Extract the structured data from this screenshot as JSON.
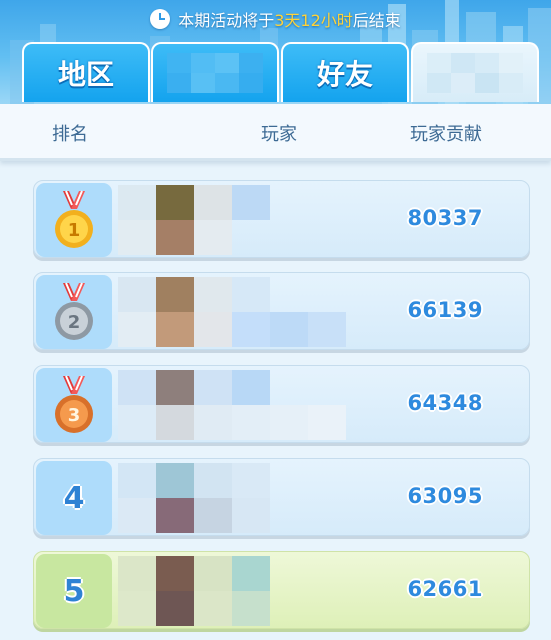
{
  "banner": {
    "notice_prefix": "本期活动将于",
    "notice_time": "3天12小时",
    "notice_suffix": "后结束",
    "icon": "clock-icon"
  },
  "tabs": [
    {
      "label": "地区",
      "active": false,
      "blurred": false
    },
    {
      "label": "",
      "active": false,
      "blurred": true
    },
    {
      "label": "好友",
      "active": false,
      "blurred": false
    },
    {
      "label": "",
      "active": true,
      "blurred": true
    }
  ],
  "columns": {
    "rank": "排名",
    "player": "玩家",
    "contribution": "玩家贡献"
  },
  "rows": [
    {
      "rank": "1",
      "medal": "gold-medal-icon",
      "player_name_hidden": true,
      "score": "80337"
    },
    {
      "rank": "2",
      "medal": "silver-medal-icon",
      "player_name_hidden": true,
      "score": "66139"
    },
    {
      "rank": "3",
      "medal": "bronze-medal-icon",
      "player_name_hidden": true,
      "score": "64348"
    },
    {
      "rank": "4",
      "medal": null,
      "player_name_hidden": true,
      "score": "63095"
    },
    {
      "rank": "5",
      "medal": null,
      "player_name_hidden": true,
      "score": "62661",
      "highlighted": true
    }
  ],
  "colors": {
    "accent_blue": "#14a3ee",
    "score_blue": "#2e8ade",
    "highlight_green": "#def0b8",
    "notice_highlight": "#ffd338"
  }
}
